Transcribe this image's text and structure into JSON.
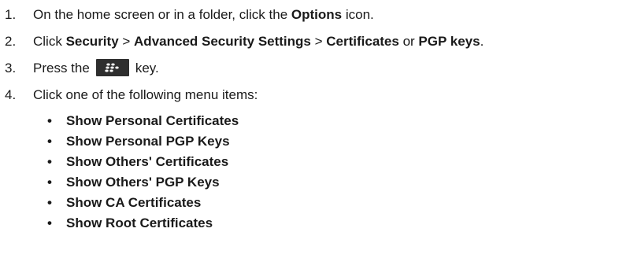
{
  "steps": [
    {
      "number": "1.",
      "text_before": "On the home screen or in a folder, click the ",
      "bold": "Options",
      "text_after": " icon."
    },
    {
      "number": "2.",
      "text_1": "Click ",
      "bold_1": "Security",
      "sep_1": " > ",
      "bold_2": "Advanced Security Settings",
      "sep_2": " > ",
      "bold_3": "Certificates",
      "text_or": " or ",
      "bold_4": "PGP keys",
      "end": "."
    },
    {
      "number": "3.",
      "text_before": "Press the",
      "icon": "blackberry-menu-key-icon",
      "text_after": "key."
    },
    {
      "number": "4.",
      "text": "Click one of the following menu items:"
    }
  ],
  "bullet_glyph": "•",
  "menu_items": [
    "Show Personal Certificates",
    "Show Personal PGP Keys",
    "Show Others' Certificates",
    "Show Others' PGP Keys",
    "Show CA Certificates",
    "Show Root Certificates"
  ],
  "colors": {
    "text": "#1a1a1a",
    "key_background": "#2e2e2e",
    "key_glyph": "#ffffff"
  }
}
